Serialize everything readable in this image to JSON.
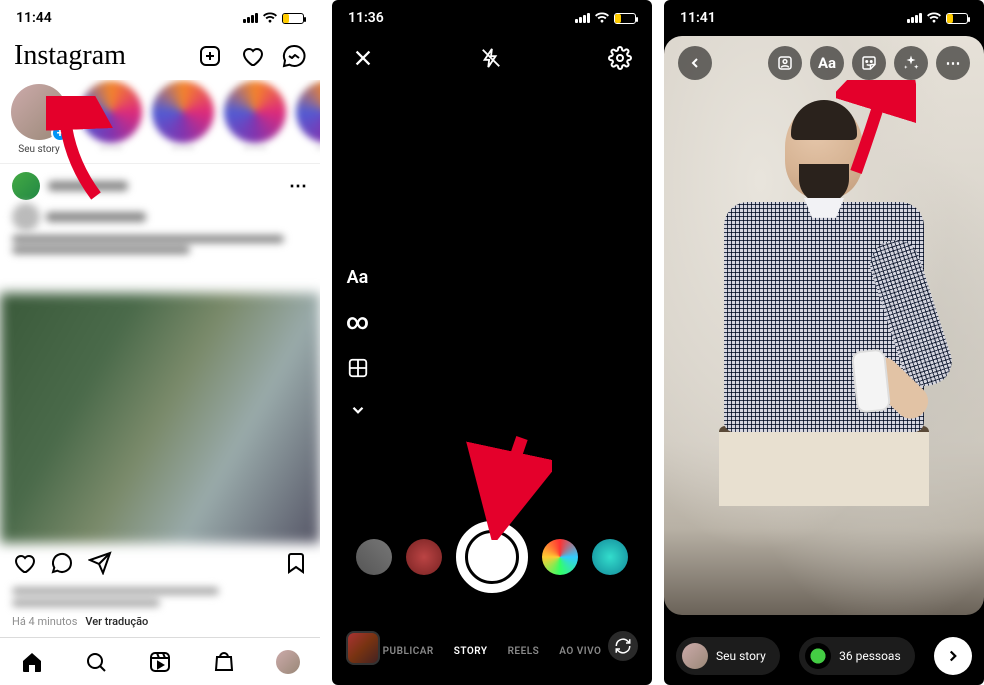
{
  "feed": {
    "status_time": "11:44",
    "logo": "Instagram",
    "your_story_label": "Seu story",
    "timestamp": "Há 4 minutos",
    "translate": "Ver tradução"
  },
  "camera": {
    "status_time": "11:36",
    "text_tool": "Aa",
    "modes": {
      "publicar": "PUBLICAR",
      "story": "STORY",
      "reels": "REELS",
      "ao_vivo": "AO VIVO"
    }
  },
  "editor": {
    "status_time": "11:41",
    "text_tool": "Aa",
    "share_your_story": "Seu story",
    "close_friends_count": "36 pessoas"
  }
}
